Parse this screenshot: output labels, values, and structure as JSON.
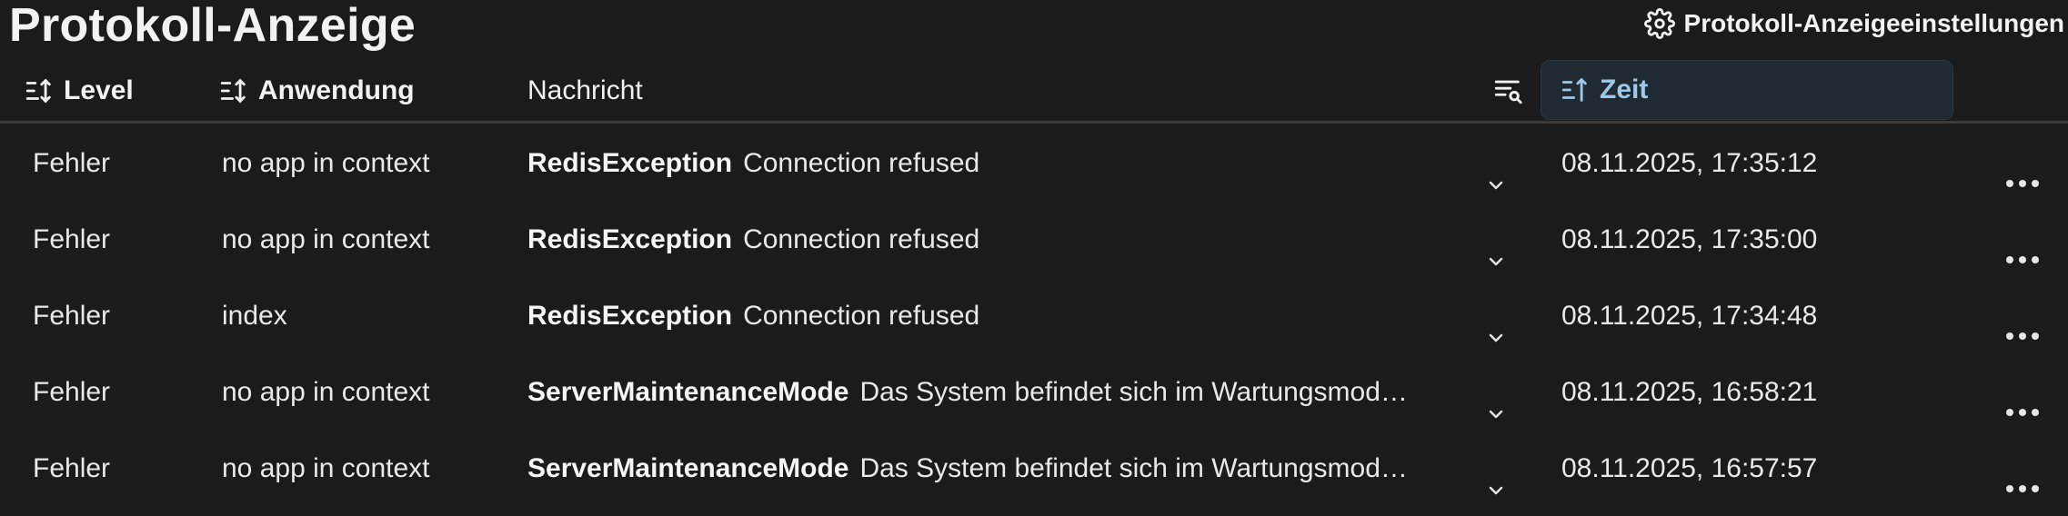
{
  "header": {
    "title": "Protokoll-Anzeige",
    "settings_label": "Protokoll-Anzeigeeinstellungen"
  },
  "columns": {
    "level": "Level",
    "app": "Anwendung",
    "message": "Nachricht",
    "time": "Zeit"
  },
  "rows": [
    {
      "level": "Fehler",
      "app": "no app in context",
      "exception": "RedisException",
      "message": "Connection refused",
      "time": "08.11.2025, 17:35:12"
    },
    {
      "level": "Fehler",
      "app": "no app in context",
      "exception": "RedisException",
      "message": "Connection refused",
      "time": "08.11.2025, 17:35:00"
    },
    {
      "level": "Fehler",
      "app": "index",
      "exception": "RedisException",
      "message": "Connection refused",
      "time": "08.11.2025, 17:34:48"
    },
    {
      "level": "Fehler",
      "app": "no app in context",
      "exception": "ServerMaintenanceMode",
      "message": "Das System befindet sich im Wartungsmod…",
      "time": "08.11.2025, 16:58:21"
    },
    {
      "level": "Fehler",
      "app": "no app in context",
      "exception": "ServerMaintenanceMode",
      "message": "Das System befindet sich im Wartungsmod…",
      "time": "08.11.2025, 16:57:57"
    }
  ],
  "icons": {
    "settings": "gear-icon",
    "sort": "sort-icon",
    "filter": "filter-search-icon",
    "expand": "chevron-down-icon",
    "more": "more-horizontal-icon"
  },
  "colors": {
    "background": "#1b1b1b",
    "active_sort": "#9ec8e8"
  }
}
